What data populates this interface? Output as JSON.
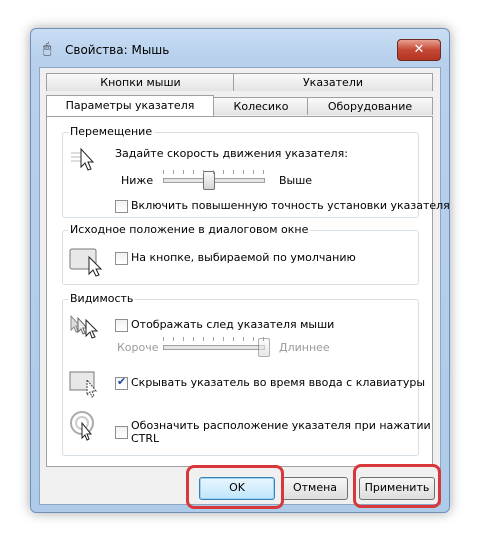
{
  "window": {
    "title": "Свойства: Мышь",
    "close_glyph": "✕"
  },
  "tabs": {
    "row_top": [
      "Кнопки мыши",
      "Указатели"
    ],
    "row_bottom": [
      "Параметры указателя",
      "Колесико",
      "Оборудование"
    ]
  },
  "motion": {
    "title": "Перемещение",
    "speed_label": "Задайте скорость движения указателя:",
    "slow": "Ниже",
    "fast": "Выше",
    "speed_value": 0.45,
    "precision_label": "Включить повышенную точность установки указателя",
    "precision_checked": false
  },
  "snap": {
    "title": "Исходное положение в диалоговом окне",
    "label": "На кнопке, выбираемой по умолчанию",
    "checked": false
  },
  "visibility": {
    "title": "Видимость",
    "trails_label": "Отображать след указателя мыши",
    "trails_checked": false,
    "short": "Короче",
    "long": "Длиннее",
    "trails_value": 1.0,
    "hide_label": "Скрывать указатель во время ввода с клавиатуры",
    "hide_checked": true,
    "show_location_label_line1": "Обозначить расположение указателя при нажатии",
    "show_location_label_line2": "CTRL",
    "show_location_checked": false
  },
  "buttons": {
    "ok": "OK",
    "cancel": "Отмена",
    "apply": "Применить"
  },
  "colors": {
    "highlight": "#d9383a",
    "check": "#1d4c9e",
    "frame": "#b8d0ec"
  }
}
